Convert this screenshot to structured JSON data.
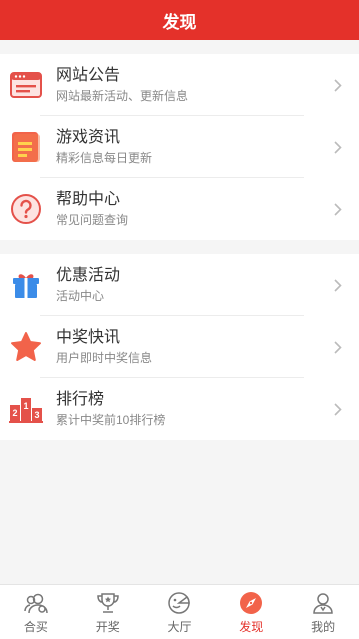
{
  "header": {
    "title": "发现"
  },
  "group1": [
    {
      "title": "网站公告",
      "sub": "网站最新活动、更新信息",
      "icon": "announcement-icon"
    },
    {
      "title": "游戏资讯",
      "sub": "精彩信息每日更新",
      "icon": "news-icon"
    },
    {
      "title": "帮助中心",
      "sub": "常见问题查询",
      "icon": "help-icon"
    }
  ],
  "group2": [
    {
      "title": "优惠活动",
      "sub": "活动中心",
      "icon": "gift-icon"
    },
    {
      "title": "中奖快讯",
      "sub": "用户即时中奖信息",
      "icon": "star-icon"
    },
    {
      "title": "排行榜",
      "sub": "累计中奖前10排行榜",
      "icon": "podium-icon"
    }
  ],
  "podium": {
    "first": "1",
    "second": "2",
    "third": "3"
  },
  "tabs": [
    {
      "label": "合买",
      "icon": "group-buy-icon"
    },
    {
      "label": "开奖",
      "icon": "trophy-icon"
    },
    {
      "label": "大厅",
      "icon": "lobby-icon"
    },
    {
      "label": "发现",
      "icon": "compass-icon",
      "active": true
    },
    {
      "label": "我的",
      "icon": "user-icon"
    }
  ],
  "colors": {
    "accent": "#e4312a"
  }
}
